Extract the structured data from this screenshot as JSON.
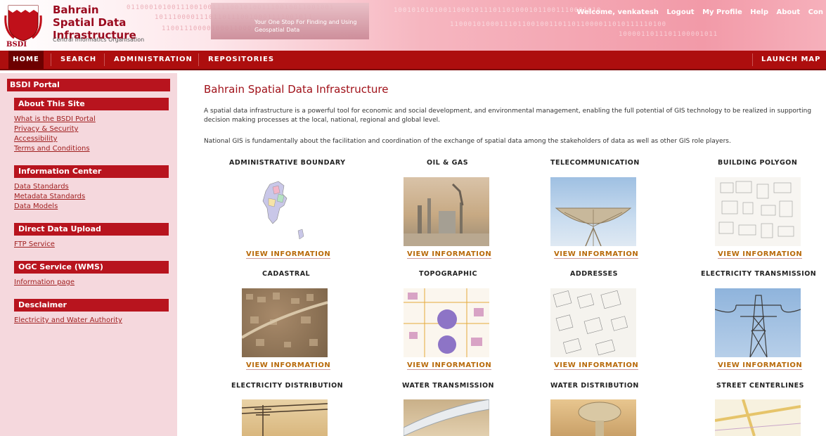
{
  "header": {
    "site_title": "Bahrain Spatial Data Infrastructure",
    "logo_abbr": "BSDI",
    "org_name": "Central Informatics Organisation",
    "tagline": "Your One Stop For Finding and Using Geospatial Data",
    "user_links": [
      "Welcome, venkatesh",
      "Logout",
      "My Profile",
      "Help",
      "About",
      "Con"
    ]
  },
  "nav": {
    "home": "HOME",
    "search": "SEARCH",
    "administration": "ADMINISTRATION",
    "repositories": "REPOSITORIES",
    "launch": "LAUNCH MAP V"
  },
  "sidebar": {
    "portal_title": "BSDI Portal",
    "sections": [
      {
        "title": "About This Site",
        "links": [
          "What is the BSDI Portal",
          "Privacy & Security",
          "Accessibility",
          "Terms and Conditions"
        ]
      },
      {
        "title": "Information Center",
        "links": [
          "Data Standards",
          "Metadata Standards",
          "Data Models"
        ]
      },
      {
        "title": "Direct Data Upload",
        "links": [
          "FTP Service"
        ]
      },
      {
        "title": "OGC Service (WMS)",
        "links": [
          "Information page"
        ]
      },
      {
        "title": "Desclaimer",
        "links": [
          "Electricity and Water Authority"
        ]
      }
    ]
  },
  "main": {
    "title": "Bahrain Spatial Data Infrastructure",
    "para1": "A spatial data infrastructure is a powerful tool for economic and social development, and environmental management, enabling the full potential of GIS technology to be realized in supporting decision making processes at the local, national, regional and global level.",
    "para2": "National GIS is fundamentally about the facilitation and coordination of the exchange of spatial data among the stakeholders of data as well as other GIS role players.",
    "view_label": "VIEW INFORMATION",
    "categories": [
      "ADMINISTRATIVE BOUNDARY",
      "OIL & GAS",
      "TELECOMMUNICATION",
      "BUILDING POLYGON",
      "CADASTRAL",
      "TOPOGRAPHIC",
      "ADDRESSES",
      "ELECTRICITY TRANSMISSION",
      "ELECTRICITY DISTRIBUTION",
      "WATER TRANSMISSION",
      "WATER DISTRIBUTION",
      "STREET CENTERLINES"
    ]
  },
  "colors": {
    "brand_red": "#ad0e0e",
    "sidebar_bg": "#f5d8dd",
    "link_orange": "#b86a0a"
  }
}
